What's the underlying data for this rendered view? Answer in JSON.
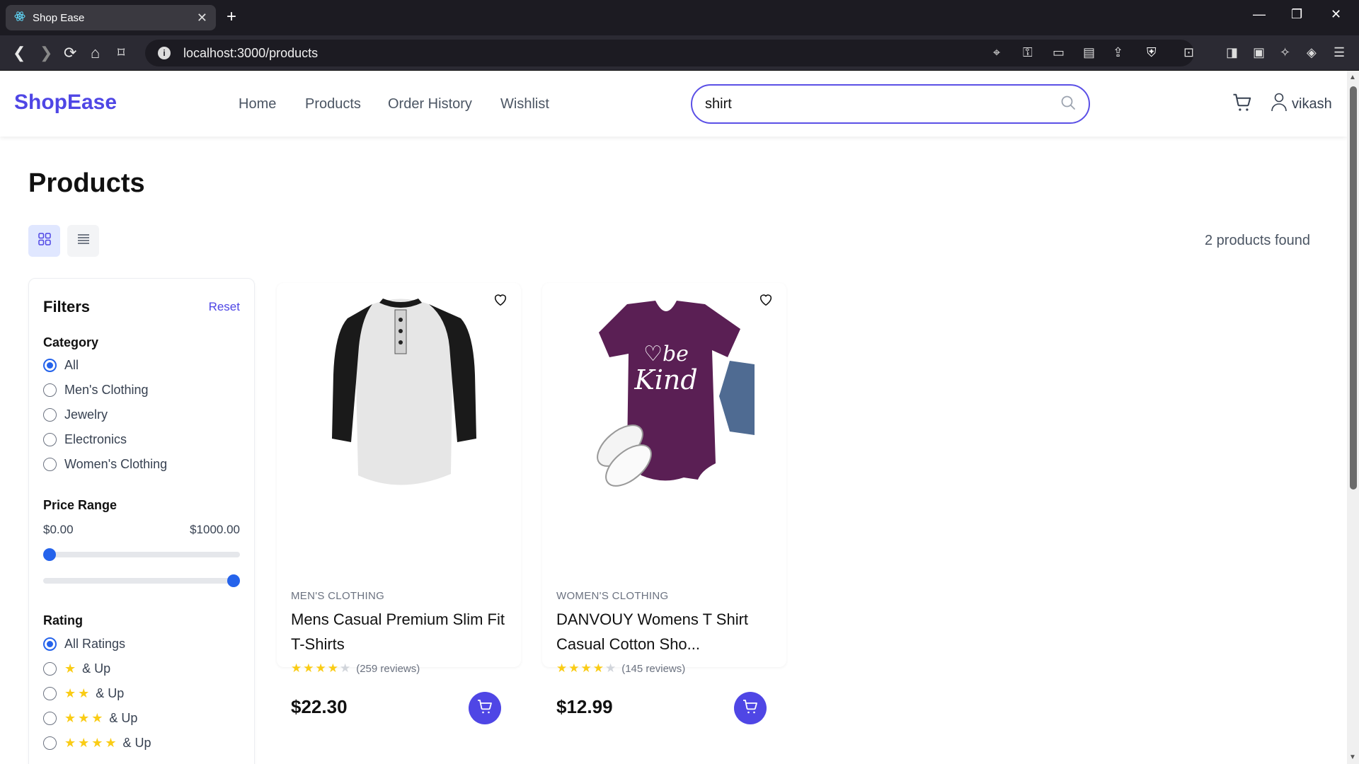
{
  "browser": {
    "tab_title": "Shop Ease",
    "url": "localhost:3000/products"
  },
  "header": {
    "logo": "ShopEase",
    "nav": [
      "Home",
      "Products",
      "Order History",
      "Wishlist"
    ],
    "search_value": "shirt",
    "user_name": "vikash"
  },
  "main": {
    "title": "Products",
    "results_count": "2 products found"
  },
  "filters": {
    "title": "Filters",
    "reset_label": "Reset",
    "category_title": "Category",
    "categories": [
      "All",
      "Men's Clothing",
      "Jewelry",
      "Electronics",
      "Women's Clothing"
    ],
    "selected_category": "All",
    "price_title": "Price Range",
    "price_min": "$0.00",
    "price_max": "$1000.00",
    "rating_title": "Rating",
    "rating_options": [
      {
        "label": "All Ratings",
        "stars": 0
      },
      {
        "label": "& Up",
        "stars": 1
      },
      {
        "label": "& Up",
        "stars": 2
      },
      {
        "label": "& Up",
        "stars": 3
      },
      {
        "label": "& Up",
        "stars": 4
      }
    ],
    "selected_rating": "All Ratings"
  },
  "products": [
    {
      "category": "MEN'S CLOTHING",
      "title": "Mens Casual Premium Slim Fit T-Shirts",
      "rating": 4,
      "reviews": "(259 reviews)",
      "price": "$22.30"
    },
    {
      "category": "WOMEN'S CLOTHING",
      "title": "DANVOUY Womens T Shirt Casual Cotton Sho...",
      "rating": 4,
      "reviews": "(145 reviews)",
      "price": "$12.99"
    }
  ],
  "colors": {
    "brand": "#4f46e5",
    "radio_active": "#2563eb",
    "star": "#facc15"
  }
}
